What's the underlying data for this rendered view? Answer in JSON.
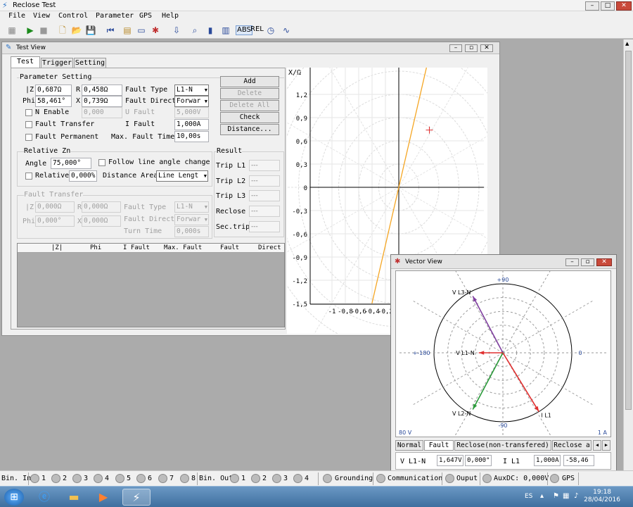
{
  "app": {
    "title": "Reclose Test"
  },
  "menu": [
    "File",
    "View",
    "Control",
    "Parameter",
    "GPS",
    "Help"
  ],
  "toolbar": {
    "abs_label": "ABS",
    "rel_label": "REL"
  },
  "testview": {
    "title": "Test View",
    "tabs": [
      "Test",
      "Trigger",
      "Setting"
    ],
    "param_group": "Parameter Setting",
    "z_label": "|Z|",
    "z_value": "0,687Ω",
    "r_label": "R",
    "r_value": "0,458Ω",
    "phi_label": "Phi",
    "phi_value": "58,461°",
    "x_label": "X",
    "x_value": "0,739Ω",
    "fault_type_label": "Fault Type",
    "fault_type_value": "L1-N",
    "fault_direct_label": "Fault Direct",
    "fault_direct_value": "Forwar",
    "n_enable_label": "N Enable",
    "n_enable_value": "0,000",
    "u_fault_label": "U Fault",
    "u_fault_value": "5,000V",
    "fault_transfer_label": "Fault Transfer",
    "i_fault_label": "I Fault",
    "i_fault_value": "1,000A",
    "fault_permanent_label": "Fault Permanent",
    "max_fault_time_label": "Max. Fault Time",
    "max_fault_time_value": "10,00s",
    "buttons": {
      "add": "Add",
      "delete": "Delete",
      "delete_all": "Delete All",
      "check": "Check",
      "distance": "Distance..."
    },
    "relative_group": "Relative Zn",
    "angle_label": "Angle",
    "angle_value": "75,000°",
    "follow_label": "Follow line angle change",
    "relative_label": "Relative",
    "relative_value": "0,000%",
    "distance_area_label": "Distance Area",
    "distance_area_value": "Line Lengt",
    "result_group": "Result",
    "results": [
      {
        "label": "Trip L1",
        "value": "---"
      },
      {
        "label": "Trip L2",
        "value": "---"
      },
      {
        "label": "Trip L3",
        "value": "---"
      },
      {
        "label": "Reclose",
        "value": "---"
      },
      {
        "label": "Sec.trip",
        "value": "---"
      }
    ],
    "ft_group": "Fault Transfer",
    "ft_z_label": "|Z|",
    "ft_z_value": "0,000Ω",
    "ft_r_label": "R",
    "ft_r_value": "0,000Ω",
    "ft_phi_label": "Phi",
    "ft_phi_value": "0,000°",
    "ft_x_label": "X",
    "ft_x_value": "0,000Ω",
    "ft_type_label": "Fault Type",
    "ft_type_value": "L1-N",
    "ft_direct_label": "Fault Direct",
    "ft_direct_value": "Forwar",
    "ft_turn_label": "Turn Time",
    "ft_turn_value": "0,000s",
    "table_headers": [
      "|Z|",
      "Phi",
      "I Fault",
      "Max. Fault",
      "Fault",
      "Direct"
    ]
  },
  "chart_data": {
    "type": "line",
    "ylabel": "X/Ω",
    "xlabel": "",
    "yticks": [
      "1,2",
      "0,9",
      "0,6",
      "0,3",
      "0",
      "-0,3",
      "-0,6",
      "-0,9",
      "-1,2",
      "-1,5"
    ],
    "xticks": [
      "-1",
      "-0,8",
      "-0,6",
      "-0,4",
      "-0,2"
    ],
    "xlim": [
      -1.05,
      1.05
    ],
    "ylim": [
      -1.5,
      1.55
    ],
    "line_angle_deg": 75,
    "line_color": "#f5a623",
    "marker": {
      "x": 0.458,
      "y": 0.739,
      "color": "#e03030"
    }
  },
  "vector": {
    "title": "Vector View",
    "labels": {
      "top": "+90",
      "bottom": "-90",
      "left": "+-180",
      "right": "0",
      "volt": "80 V",
      "amp": "1 A"
    },
    "phasors": [
      {
        "name": "V L3-N",
        "angle": 118,
        "mag": 0.93,
        "color": "#8040a0"
      },
      {
        "name": "V L1-N",
        "angle": 180,
        "mag": 0.35,
        "color": "#e03030"
      },
      {
        "name": "V L2-N",
        "angle": -118,
        "mag": 0.93,
        "color": "#2a9a3a"
      },
      {
        "name": "I L1",
        "angle": -58.5,
        "mag": 1.0,
        "color": "#e03030"
      }
    ],
    "tabs": [
      "Normal",
      "Fault",
      "Reclose(non-transfered)",
      "Reclose a"
    ],
    "row": {
      "v_label": "V L1-N",
      "v_mag": "1,647V",
      "v_ang": "0,000°",
      "i_label": "I L1",
      "i_mag": "1,000A",
      "i_ang": "-58,46"
    }
  },
  "status": {
    "bin_in": "Bin. In",
    "bin_in_items": [
      "1",
      "2",
      "3",
      "4",
      "5",
      "6",
      "7",
      "8"
    ],
    "bin_out": "Bin. Out",
    "bin_out_items": [
      "1",
      "2",
      "3",
      "4"
    ],
    "grounding": "Grounding",
    "communication": "Communication",
    "output": "Ouput",
    "auxdc": "AuxDC: 0,000V",
    "gps": "GPS"
  },
  "taskbar": {
    "lang": "ES",
    "time": "19:18",
    "date": "28/04/2016"
  }
}
